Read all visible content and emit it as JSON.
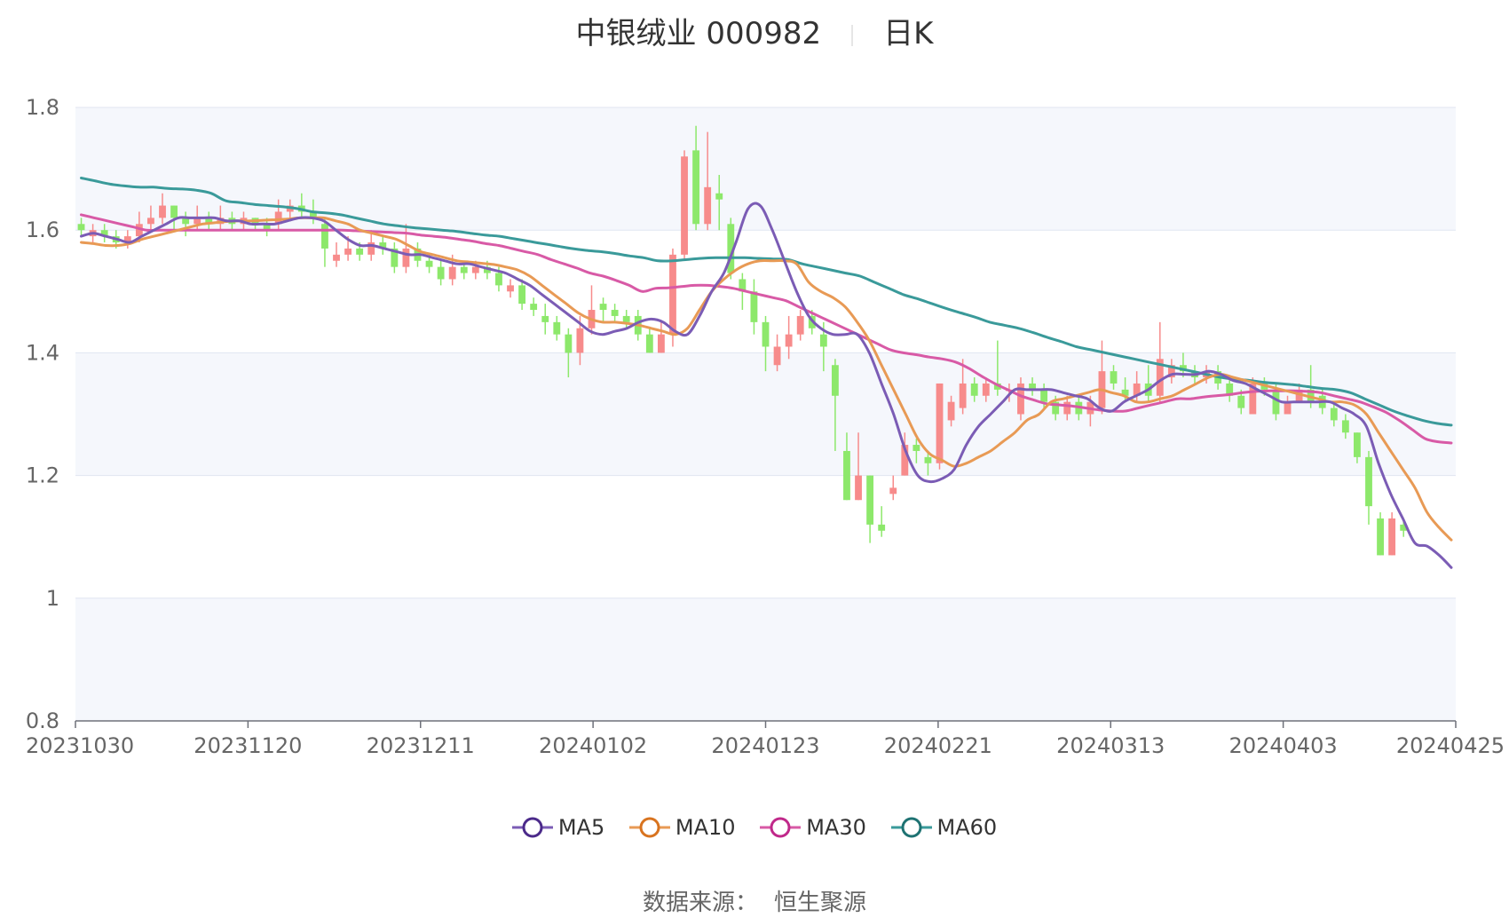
{
  "title": {
    "stock": "中银绒业 000982",
    "period": "日K"
  },
  "source": {
    "label": "数据来源：",
    "value": "恒生聚源"
  },
  "colors": {
    "up": "#f78b8b",
    "down": "#8de86b",
    "ma5": "#7b5cb5",
    "ma10": "#e89a55",
    "ma30": "#d85aa6",
    "ma60": "#3a9a9a"
  },
  "chart_data": {
    "type": "candlestick",
    "ylim": [
      0.8,
      1.8
    ],
    "yticks": [
      "0.8",
      "1",
      "1.2",
      "1.4",
      "1.6",
      "1.8"
    ],
    "xticks": [
      "20231030",
      "20231120",
      "20231211",
      "20240102",
      "20240123",
      "20240221",
      "20240313",
      "20240403",
      "20240425"
    ],
    "legend": [
      "MA5",
      "MA10",
      "MA30",
      "MA60"
    ],
    "n": 119,
    "ohlc": [
      [
        1.61,
        1.6,
        1.62,
        1.59
      ],
      [
        1.59,
        1.6,
        1.61,
        1.58
      ],
      [
        1.6,
        1.59,
        1.61,
        1.58
      ],
      [
        1.59,
        1.58,
        1.6,
        1.57
      ],
      [
        1.58,
        1.59,
        1.6,
        1.57
      ],
      [
        1.59,
        1.61,
        1.63,
        1.58
      ],
      [
        1.61,
        1.62,
        1.64,
        1.6
      ],
      [
        1.62,
        1.64,
        1.66,
        1.61
      ],
      [
        1.64,
        1.62,
        1.64,
        1.6
      ],
      [
        1.62,
        1.61,
        1.63,
        1.59
      ],
      [
        1.61,
        1.62,
        1.64,
        1.6
      ],
      [
        1.62,
        1.61,
        1.63,
        1.6
      ],
      [
        1.61,
        1.62,
        1.64,
        1.6
      ],
      [
        1.62,
        1.61,
        1.63,
        1.6
      ],
      [
        1.61,
        1.62,
        1.63,
        1.6
      ],
      [
        1.62,
        1.61,
        1.62,
        1.6
      ],
      [
        1.61,
        1.6,
        1.62,
        1.59
      ],
      [
        1.61,
        1.63,
        1.65,
        1.6
      ],
      [
        1.63,
        1.64,
        1.65,
        1.62
      ],
      [
        1.64,
        1.63,
        1.66,
        1.62
      ],
      [
        1.63,
        1.62,
        1.65,
        1.61
      ],
      [
        1.61,
        1.57,
        1.62,
        1.54
      ],
      [
        1.55,
        1.56,
        1.58,
        1.54
      ],
      [
        1.56,
        1.57,
        1.59,
        1.55
      ],
      [
        1.57,
        1.56,
        1.58,
        1.55
      ],
      [
        1.56,
        1.58,
        1.6,
        1.55
      ],
      [
        1.58,
        1.57,
        1.59,
        1.56
      ],
      [
        1.57,
        1.54,
        1.58,
        1.53
      ],
      [
        1.54,
        1.57,
        1.61,
        1.53
      ],
      [
        1.57,
        1.55,
        1.58,
        1.54
      ],
      [
        1.55,
        1.54,
        1.56,
        1.53
      ],
      [
        1.54,
        1.52,
        1.55,
        1.51
      ],
      [
        1.52,
        1.54,
        1.56,
        1.51
      ],
      [
        1.54,
        1.53,
        1.55,
        1.52
      ],
      [
        1.53,
        1.54,
        1.55,
        1.52
      ],
      [
        1.54,
        1.53,
        1.55,
        1.52
      ],
      [
        1.53,
        1.51,
        1.54,
        1.5
      ],
      [
        1.5,
        1.51,
        1.52,
        1.49
      ],
      [
        1.51,
        1.48,
        1.52,
        1.47
      ],
      [
        1.48,
        1.47,
        1.49,
        1.46
      ],
      [
        1.46,
        1.45,
        1.48,
        1.43
      ],
      [
        1.45,
        1.43,
        1.46,
        1.42
      ],
      [
        1.43,
        1.4,
        1.44,
        1.36
      ],
      [
        1.4,
        1.44,
        1.46,
        1.38
      ],
      [
        1.44,
        1.47,
        1.51,
        1.43
      ],
      [
        1.48,
        1.47,
        1.49,
        1.45
      ],
      [
        1.47,
        1.46,
        1.48,
        1.45
      ],
      [
        1.46,
        1.45,
        1.47,
        1.44
      ],
      [
        1.46,
        1.43,
        1.47,
        1.42
      ],
      [
        1.43,
        1.4,
        1.44,
        1.4
      ],
      [
        1.4,
        1.43,
        1.45,
        1.4
      ],
      [
        1.43,
        1.56,
        1.57,
        1.41
      ],
      [
        1.56,
        1.72,
        1.73,
        1.55
      ],
      [
        1.73,
        1.61,
        1.77,
        1.6
      ],
      [
        1.61,
        1.67,
        1.76,
        1.6
      ],
      [
        1.66,
        1.65,
        1.69,
        1.6
      ],
      [
        1.61,
        1.53,
        1.62,
        1.52
      ],
      [
        1.52,
        1.5,
        1.53,
        1.47
      ],
      [
        1.5,
        1.45,
        1.52,
        1.43
      ],
      [
        1.45,
        1.41,
        1.46,
        1.37
      ],
      [
        1.38,
        1.41,
        1.43,
        1.37
      ],
      [
        1.41,
        1.43,
        1.46,
        1.39
      ],
      [
        1.43,
        1.46,
        1.47,
        1.42
      ],
      [
        1.46,
        1.44,
        1.47,
        1.43
      ],
      [
        1.43,
        1.41,
        1.45,
        1.37
      ],
      [
        1.38,
        1.33,
        1.39,
        1.24
      ],
      [
        1.24,
        1.16,
        1.27,
        1.16
      ],
      [
        1.16,
        1.2,
        1.27,
        1.16
      ],
      [
        1.2,
        1.12,
        1.2,
        1.09
      ],
      [
        1.12,
        1.11,
        1.15,
        1.1
      ],
      [
        1.17,
        1.18,
        1.2,
        1.16
      ],
      [
        1.2,
        1.25,
        1.27,
        1.2
      ],
      [
        1.25,
        1.24,
        1.26,
        1.22
      ],
      [
        1.23,
        1.22,
        1.24,
        1.2
      ],
      [
        1.22,
        1.35,
        1.35,
        1.21
      ],
      [
        1.29,
        1.32,
        1.33,
        1.28
      ],
      [
        1.31,
        1.35,
        1.39,
        1.3
      ],
      [
        1.35,
        1.33,
        1.36,
        1.32
      ],
      [
        1.33,
        1.35,
        1.36,
        1.32
      ],
      [
        1.35,
        1.34,
        1.42,
        1.33
      ],
      [
        1.34,
        1.34,
        1.35,
        1.32
      ],
      [
        1.3,
        1.35,
        1.36,
        1.29
      ],
      [
        1.35,
        1.34,
        1.36,
        1.33
      ],
      [
        1.34,
        1.32,
        1.35,
        1.31
      ],
      [
        1.32,
        1.3,
        1.33,
        1.29
      ],
      [
        1.3,
        1.32,
        1.33,
        1.29
      ],
      [
        1.32,
        1.3,
        1.33,
        1.29
      ],
      [
        1.3,
        1.32,
        1.33,
        1.28
      ],
      [
        1.31,
        1.37,
        1.42,
        1.3
      ],
      [
        1.37,
        1.35,
        1.38,
        1.34
      ],
      [
        1.34,
        1.33,
        1.36,
        1.32
      ],
      [
        1.33,
        1.35,
        1.37,
        1.32
      ],
      [
        1.35,
        1.33,
        1.38,
        1.32
      ],
      [
        1.33,
        1.39,
        1.45,
        1.32
      ],
      [
        1.36,
        1.38,
        1.39,
        1.35
      ],
      [
        1.38,
        1.37,
        1.4,
        1.36
      ],
      [
        1.37,
        1.36,
        1.38,
        1.35
      ],
      [
        1.36,
        1.37,
        1.38,
        1.35
      ],
      [
        1.37,
        1.35,
        1.38,
        1.34
      ],
      [
        1.35,
        1.33,
        1.36,
        1.32
      ],
      [
        1.33,
        1.31,
        1.34,
        1.3
      ],
      [
        1.3,
        1.35,
        1.36,
        1.3
      ],
      [
        1.35,
        1.34,
        1.36,
        1.33
      ],
      [
        1.34,
        1.3,
        1.35,
        1.29
      ],
      [
        1.3,
        1.32,
        1.33,
        1.3
      ],
      [
        1.32,
        1.34,
        1.35,
        1.32
      ],
      [
        1.34,
        1.32,
        1.38,
        1.31
      ],
      [
        1.33,
        1.31,
        1.34,
        1.3
      ],
      [
        1.31,
        1.29,
        1.32,
        1.28
      ],
      [
        1.29,
        1.27,
        1.3,
        1.26
      ],
      [
        1.27,
        1.23,
        1.27,
        1.22
      ],
      [
        1.23,
        1.15,
        1.24,
        1.12
      ],
      [
        1.13,
        1.07,
        1.14,
        1.07
      ],
      [
        1.07,
        1.13,
        1.14,
        1.07
      ],
      [
        1.12,
        1.11,
        1.13,
        1.1
      ]
    ],
    "ma5": [
      1.59,
      1.595,
      1.59,
      1.585,
      1.58,
      1.59,
      1.6,
      1.61,
      1.62,
      1.62,
      1.62,
      1.62,
      1.615,
      1.615,
      1.61,
      1.61,
      1.61,
      1.615,
      1.62,
      1.62,
      1.615,
      1.6,
      1.585,
      1.575,
      1.575,
      1.57,
      1.565,
      1.56,
      1.56,
      1.555,
      1.55,
      1.545,
      1.545,
      1.54,
      1.535,
      1.53,
      1.52,
      1.51,
      1.495,
      1.48,
      1.465,
      1.45,
      1.435,
      1.43,
      1.435,
      1.44,
      1.45,
      1.455,
      1.45,
      1.435,
      1.43,
      1.46,
      1.5,
      1.53,
      1.58,
      1.635,
      1.64,
      1.6,
      1.55,
      1.5,
      1.46,
      1.44,
      1.43,
      1.43,
      1.43,
      1.4,
      1.35,
      1.3,
      1.24,
      1.2,
      1.19,
      1.195,
      1.21,
      1.25,
      1.28,
      1.3,
      1.32,
      1.34,
      1.34,
      1.34,
      1.34,
      1.335,
      1.33,
      1.325,
      1.31,
      1.305,
      1.32,
      1.33,
      1.34,
      1.355,
      1.365,
      1.365,
      1.365,
      1.37,
      1.365,
      1.355,
      1.35,
      1.34,
      1.33,
      1.32,
      1.32,
      1.32,
      1.32,
      1.32,
      1.31,
      1.3,
      1.28,
      1.22,
      1.17,
      1.13,
      1.09,
      1.085,
      1.07,
      1.05
    ],
    "ma10": [
      1.58,
      1.578,
      1.575,
      1.575,
      1.578,
      1.585,
      1.59,
      1.595,
      1.6,
      1.605,
      1.61,
      1.612,
      1.614,
      1.615,
      1.615,
      1.616,
      1.617,
      1.618,
      1.62,
      1.62,
      1.62,
      1.615,
      1.61,
      1.6,
      1.595,
      1.59,
      1.585,
      1.575,
      1.565,
      1.56,
      1.555,
      1.55,
      1.548,
      1.546,
      1.544,
      1.54,
      1.535,
      1.525,
      1.51,
      1.495,
      1.48,
      1.465,
      1.455,
      1.45,
      1.45,
      1.448,
      1.445,
      1.44,
      1.435,
      1.43,
      1.44,
      1.47,
      1.5,
      1.52,
      1.535,
      1.545,
      1.55,
      1.55,
      1.55,
      1.545,
      1.515,
      1.5,
      1.49,
      1.475,
      1.45,
      1.42,
      1.38,
      1.34,
      1.3,
      1.26,
      1.235,
      1.225,
      1.215,
      1.22,
      1.23,
      1.24,
      1.255,
      1.27,
      1.29,
      1.3,
      1.32,
      1.325,
      1.33,
      1.335,
      1.34,
      1.335,
      1.33,
      1.32,
      1.32,
      1.325,
      1.33,
      1.34,
      1.35,
      1.36,
      1.365,
      1.36,
      1.355,
      1.35,
      1.345,
      1.34,
      1.335,
      1.33,
      1.325,
      1.32,
      1.32,
      1.315,
      1.3,
      1.27,
      1.24,
      1.21,
      1.18,
      1.14,
      1.115,
      1.095
    ],
    "ma30": [
      1.625,
      1.62,
      1.615,
      1.61,
      1.605,
      1.6,
      1.6,
      1.6,
      1.6,
      1.6,
      1.6,
      1.6,
      1.6,
      1.6,
      1.6,
      1.6,
      1.6,
      1.6,
      1.6,
      1.6,
      1.6,
      1.599,
      1.598,
      1.597,
      1.596,
      1.595,
      1.592,
      1.59,
      1.588,
      1.585,
      1.582,
      1.578,
      1.575,
      1.57,
      1.565,
      1.56,
      1.552,
      1.545,
      1.538,
      1.53,
      1.525,
      1.518,
      1.51,
      1.5,
      1.505,
      1.506,
      1.508,
      1.51,
      1.51,
      1.508,
      1.505,
      1.5,
      1.495,
      1.49,
      1.485,
      1.475,
      1.465,
      1.455,
      1.445,
      1.435,
      1.425,
      1.415,
      1.405,
      1.4,
      1.397,
      1.393,
      1.39,
      1.385,
      1.375,
      1.362,
      1.35,
      1.34,
      1.33,
      1.323,
      1.317,
      1.315,
      1.313,
      1.31,
      1.307,
      1.305,
      1.305,
      1.31,
      1.315,
      1.32,
      1.325,
      1.325,
      1.328,
      1.33,
      1.332,
      1.335,
      1.337,
      1.338,
      1.338,
      1.338,
      1.337,
      1.335,
      1.33,
      1.325,
      1.32,
      1.312,
      1.303,
      1.29,
      1.275,
      1.26,
      1.255,
      1.253
    ],
    "ma60": [
      1.685,
      1.68,
      1.675,
      1.672,
      1.67,
      1.67,
      1.668,
      1.667,
      1.665,
      1.66,
      1.648,
      1.645,
      1.642,
      1.64,
      1.638,
      1.635,
      1.63,
      1.628,
      1.625,
      1.62,
      1.615,
      1.61,
      1.607,
      1.604,
      1.602,
      1.6,
      1.598,
      1.595,
      1.592,
      1.59,
      1.586,
      1.582,
      1.578,
      1.574,
      1.57,
      1.567,
      1.565,
      1.562,
      1.558,
      1.555,
      1.55,
      1.55,
      1.552,
      1.554,
      1.555,
      1.555,
      1.555,
      1.554,
      1.553,
      1.552,
      1.545,
      1.54,
      1.535,
      1.53,
      1.525,
      1.515,
      1.505,
      1.495,
      1.488,
      1.48,
      1.472,
      1.465,
      1.458,
      1.45,
      1.445,
      1.44,
      1.433,
      1.425,
      1.418,
      1.41,
      1.405,
      1.4,
      1.395,
      1.39,
      1.385,
      1.38,
      1.375,
      1.37,
      1.365,
      1.36,
      1.357,
      1.355,
      1.352,
      1.35,
      1.348,
      1.345,
      1.342,
      1.34,
      1.335,
      1.325,
      1.315,
      1.305,
      1.297,
      1.29,
      1.285,
      1.282
    ]
  }
}
